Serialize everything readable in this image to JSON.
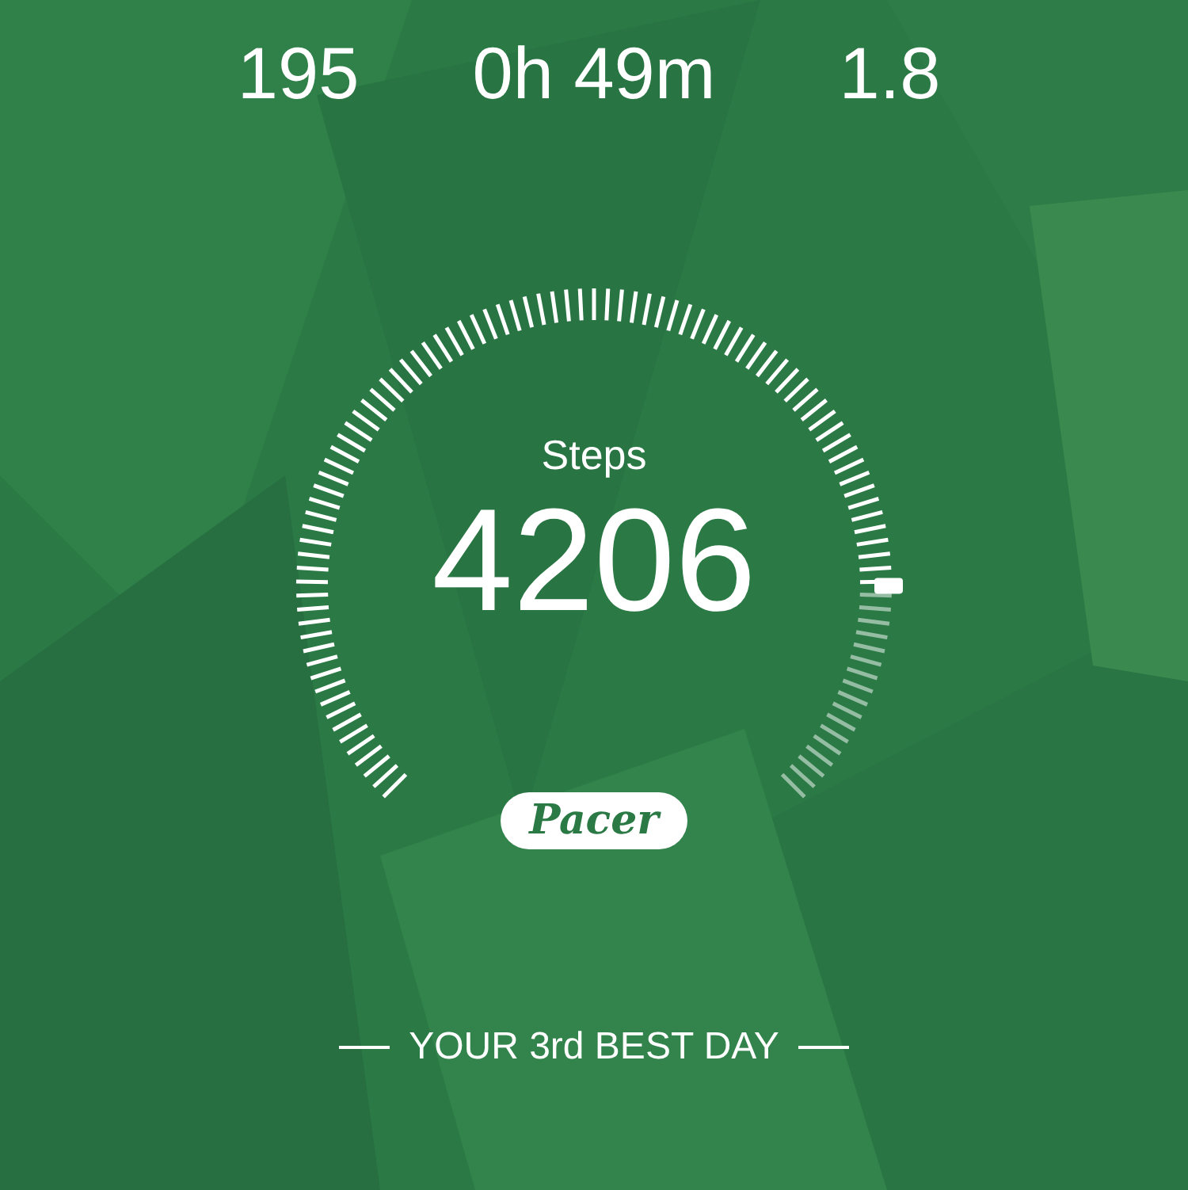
{
  "stats": [
    {
      "value": "195"
    },
    {
      "value": "0h 49m"
    },
    {
      "value": "1.8"
    }
  ],
  "steps": {
    "label": "Steps",
    "value": "4206"
  },
  "badge": "Pacer",
  "footer": "YOUR 3rd BEST DAY"
}
